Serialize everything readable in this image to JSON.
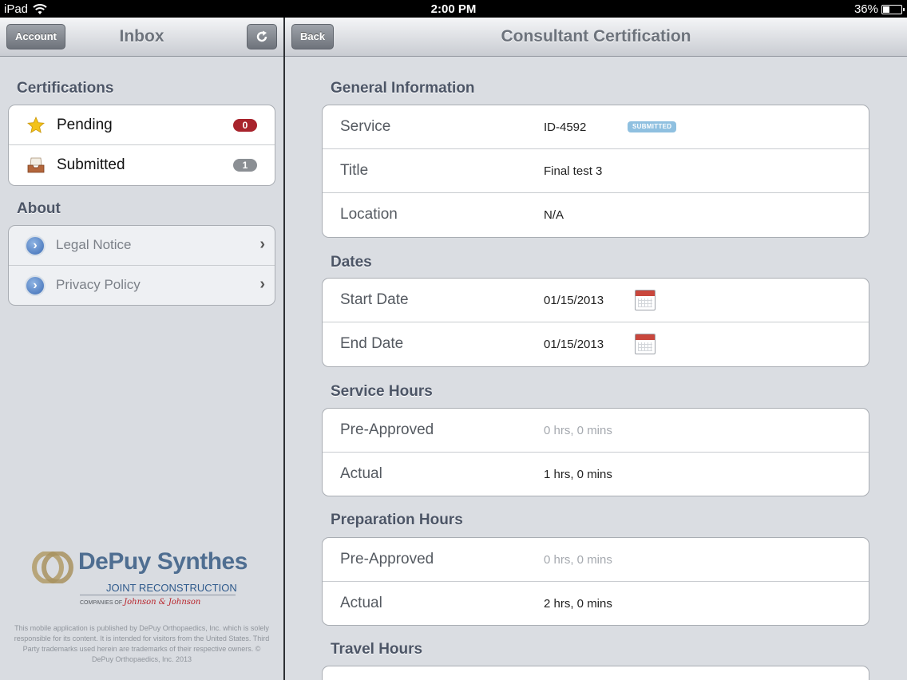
{
  "status_bar": {
    "device": "iPad",
    "time": "2:00 PM",
    "battery": "36%",
    "battery_level": 0.36
  },
  "master": {
    "nav": {
      "title": "Inbox",
      "account_label": "Account",
      "refresh_icon": "refresh-icon"
    },
    "certifications": {
      "header": "Certifications",
      "items": [
        {
          "label": "Pending",
          "badge": "0",
          "icon": "star-icon",
          "badge_color": "#a8232c"
        },
        {
          "label": "Submitted",
          "badge": "1",
          "icon": "inbox-tray-icon",
          "badge_color": "#8b8f94"
        }
      ]
    },
    "about": {
      "header": "About",
      "items": [
        {
          "label": "Legal Notice",
          "icon": "disclosure-icon"
        },
        {
          "label": "Privacy Policy",
          "icon": "disclosure-icon"
        }
      ]
    },
    "logo": {
      "brand": "DePuy Synthes",
      "subtitle": "JOINT RECONSTRUCTION",
      "companies_of": "COMPANIES OF",
      "parent": "Johnson & Johnson"
    },
    "disclaimer": "This mobile application is published by DePuy Orthopaedics, Inc. which is solely responsible for its content. It is intended for visitors from the United States. Third Party trademarks used herein are trademarks of their respective owners.  © DePuy Orthopaedics, Inc. 2013"
  },
  "detail": {
    "nav": {
      "title": "Consultant Certification",
      "back_label": "Back"
    },
    "general": {
      "header": "General Information",
      "service_label": "Service",
      "service_value": "ID-4592",
      "status_pill": "SUBMITTED",
      "title_label": "Title",
      "title_value": "Final test 3",
      "location_label": "Location",
      "location_value": "N/A"
    },
    "dates": {
      "header": "Dates",
      "start_label": "Start Date",
      "start_value": "01/15/2013",
      "end_label": "End Date",
      "end_value": "01/15/2013",
      "calendar_icon": "calendar-icon"
    },
    "service_hours": {
      "header": "Service Hours",
      "preapproved_label": "Pre-Approved",
      "preapproved_value": "0 hrs, 0 mins",
      "actual_label": "Actual",
      "actual_value": "1 hrs, 0 mins"
    },
    "preparation_hours": {
      "header": "Preparation Hours",
      "preapproved_label": "Pre-Approved",
      "preapproved_value": "0 hrs, 0 mins",
      "actual_label": "Actual",
      "actual_value": "2 hrs, 0 mins"
    },
    "travel_hours": {
      "header": "Travel Hours"
    }
  },
  "colors": {
    "pill_blue": "#8fc0e0",
    "badge_red": "#a8232c",
    "section_text": "#4c5566"
  }
}
